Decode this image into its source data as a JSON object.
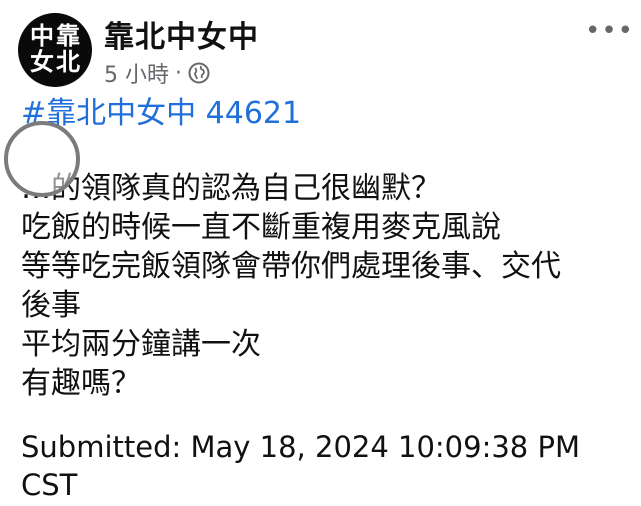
{
  "post": {
    "avatar": {
      "chars": [
        "中",
        "靠",
        "女",
        "北"
      ]
    },
    "page_name": "靠北中女中",
    "timestamp": "5 小時",
    "separator": "·",
    "hashtag": "#靠北中女中 44621",
    "body_lines": [
      "…的領隊真的認為自己很幽默？",
      "吃飯的時候一直不斷重複用麥克風說",
      "等等吃完飯領隊會帶你們處理後事、交代",
      "後事",
      "平均兩分鐘講一次",
      "有趣嗎？"
    ],
    "submitted_line1": "Submitted:  May 18, 2024 10:09:38 PM",
    "submitted_line2": "CST"
  },
  "icons": {
    "globe": "globe-icon",
    "more": "more-options-icon"
  },
  "colors": {
    "hashtag": "#216fdb",
    "meta": "#65676b",
    "avatar_bg": "#0a0a0a"
  }
}
